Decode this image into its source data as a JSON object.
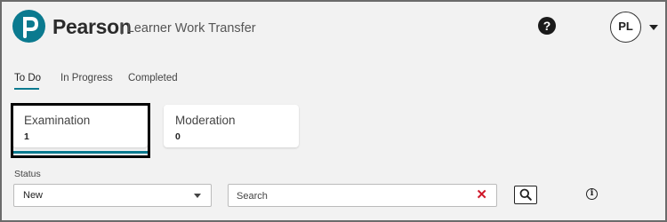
{
  "header": {
    "brand": "Pearson",
    "app_title": "| Learner Work Transfer",
    "help_symbol": "?",
    "user_initials": "PL"
  },
  "tabs": [
    {
      "label": "To Do",
      "active": true
    },
    {
      "label": "In Progress",
      "active": false
    },
    {
      "label": "Completed",
      "active": false
    }
  ],
  "cards": [
    {
      "title": "Examination",
      "count": "1",
      "selected": true
    },
    {
      "title": "Moderation",
      "count": "0",
      "selected": false
    }
  ],
  "filters": {
    "status_label": "Status",
    "status_value": "New",
    "search_placeholder": "Search",
    "clear_symbol": "✕"
  },
  "icons": {
    "logo": "pearson-logo-icon",
    "help": "help-icon",
    "dropdown": "chevron-down-icon",
    "clear": "close-icon",
    "search": "search-icon",
    "info": "info-icon"
  },
  "colors": {
    "accent": "#0b7a8f",
    "clear": "#d0192b",
    "background": "#f2f2f2"
  }
}
